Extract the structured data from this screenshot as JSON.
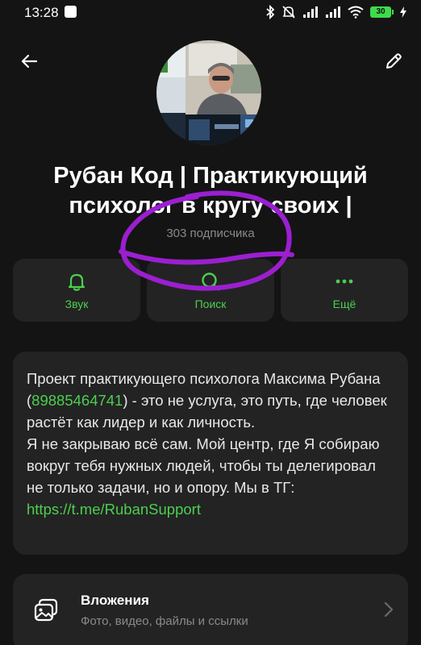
{
  "status_bar": {
    "time": "13:28",
    "battery": "30",
    "icons": [
      "notification-icon",
      "bluetooth-icon",
      "mute-icon",
      "signal-icon",
      "wifi-icon",
      "battery-icon",
      "charging-icon"
    ]
  },
  "header": {
    "back_icon": "arrow-left-icon",
    "edit_icon": "pencil-icon"
  },
  "channel": {
    "title": "Рубан Код | Практикующий психолог в кругу своих |",
    "subscribers": "303 подписчика"
  },
  "actions": [
    {
      "label": "Звук",
      "icon": "bell-icon"
    },
    {
      "label": "Поиск",
      "icon": "search-icon"
    },
    {
      "label": "Ещё",
      "icon": "more-dots-icon"
    }
  ],
  "description": {
    "part1": "Проект практикующего психолога Максима Рубана (",
    "phone": "89885464741",
    "part2": ") -  это не услуга, это путь, где человек растёт как лидер и как личность.",
    "part3": "Я не закрываю всё сам. Мой центр, где Я собираю вокруг тебя нужных людей, чтобы ты делегировал не только задачи, но и опору. Мы в ТГ: ",
    "link": "https://t.me/RubanSupport"
  },
  "attachments": {
    "title": "Вложения",
    "subtitle": "Фото, видео, файлы и ссылки",
    "icon": "media-gallery-icon"
  },
  "colors": {
    "background": "#141414",
    "card": "#232323",
    "accent_green": "#4ccf50",
    "annotation_purple": "#9b1fd0"
  }
}
